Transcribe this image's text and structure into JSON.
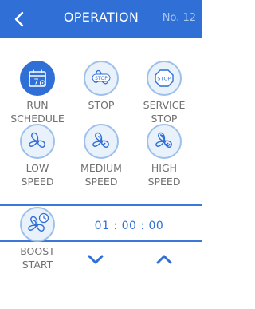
{
  "header": {
    "title": "OPERATION",
    "number": "No. 12"
  },
  "buttons": {
    "run_schedule": {
      "line1": "RUN",
      "line2": "SCHEDULE",
      "day": "7"
    },
    "stop": {
      "line1": "STOP",
      "icon_text": "STOP"
    },
    "service_stop": {
      "line1": "SERVICE",
      "line2": "STOP",
      "icon_text": "STOP"
    },
    "low_speed": {
      "line1": "LOW",
      "line2": "SPEED"
    },
    "medium_speed": {
      "line1": "MEDIUM",
      "line2": "SPEED"
    },
    "high_speed": {
      "line1": "HIGH",
      "line2": "SPEED"
    },
    "boost_start": {
      "line1": "BOOST",
      "line2": "START"
    }
  },
  "timer": {
    "value": "01 : 00 : 00"
  },
  "icons": {
    "back": "chevron-left-icon",
    "calendar": "calendar-icon",
    "fan": "fan-icon",
    "clock": "clock-icon",
    "down": "chevron-down-icon",
    "up": "chevron-up-icon"
  },
  "colors": {
    "primary": "#2f6fd6",
    "icon_bg": "#e9f1fb",
    "text": "#707070"
  }
}
